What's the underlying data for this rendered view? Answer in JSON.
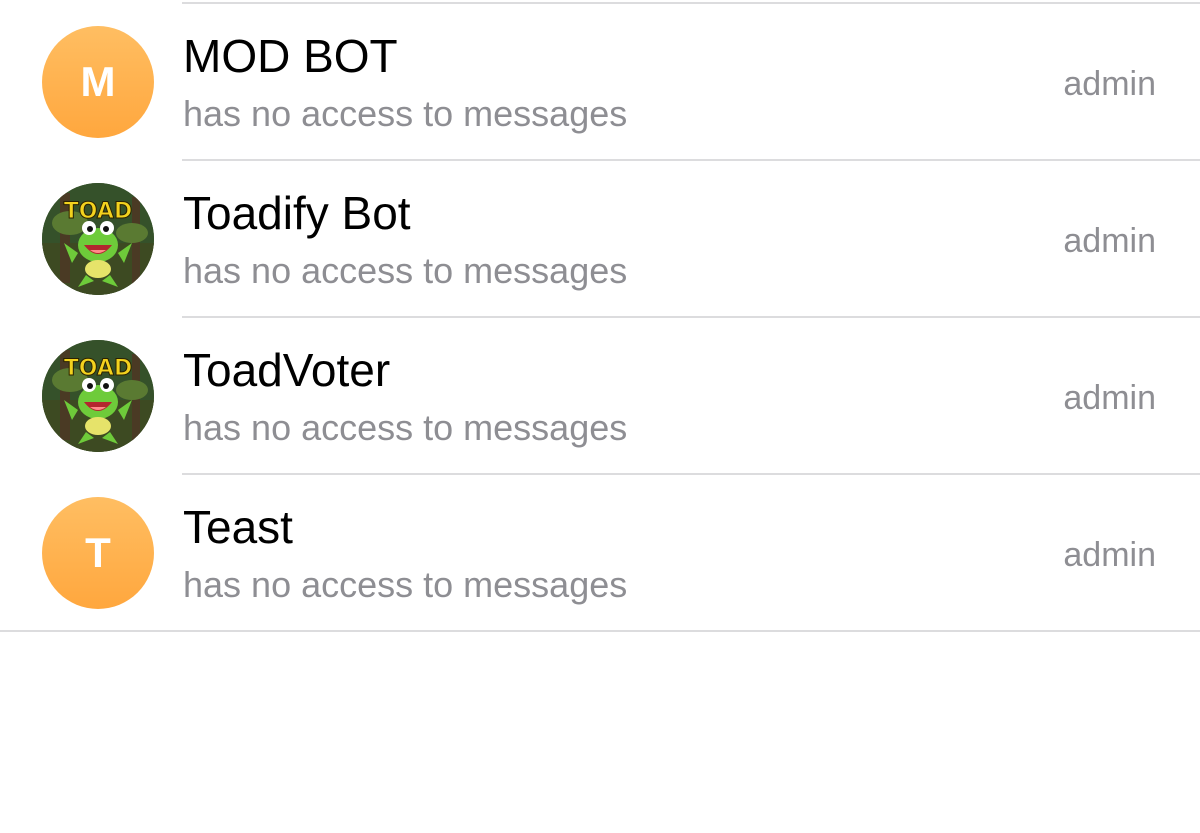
{
  "members": [
    {
      "name": "MOD BOT",
      "status": "has no access to messages",
      "role": "admin",
      "avatar_letter": "M",
      "avatar_type": "letter"
    },
    {
      "name": "Toadify Bot",
      "status": "has no access to messages",
      "role": "admin",
      "avatar_type": "image",
      "avatar_text": "TOAD"
    },
    {
      "name": "ToadVoter",
      "status": "has no access to messages",
      "role": "admin",
      "avatar_type": "image",
      "avatar_text": "TOAD"
    },
    {
      "name": "Teast",
      "status": "has no access to messages",
      "role": "admin",
      "avatar_letter": "T",
      "avatar_type": "letter"
    }
  ],
  "colors": {
    "avatar_gradient_top": "#ffbe62",
    "avatar_gradient_bottom": "#ffa73e",
    "secondary_text": "#8e8e93",
    "divider": "#dcdcde"
  }
}
